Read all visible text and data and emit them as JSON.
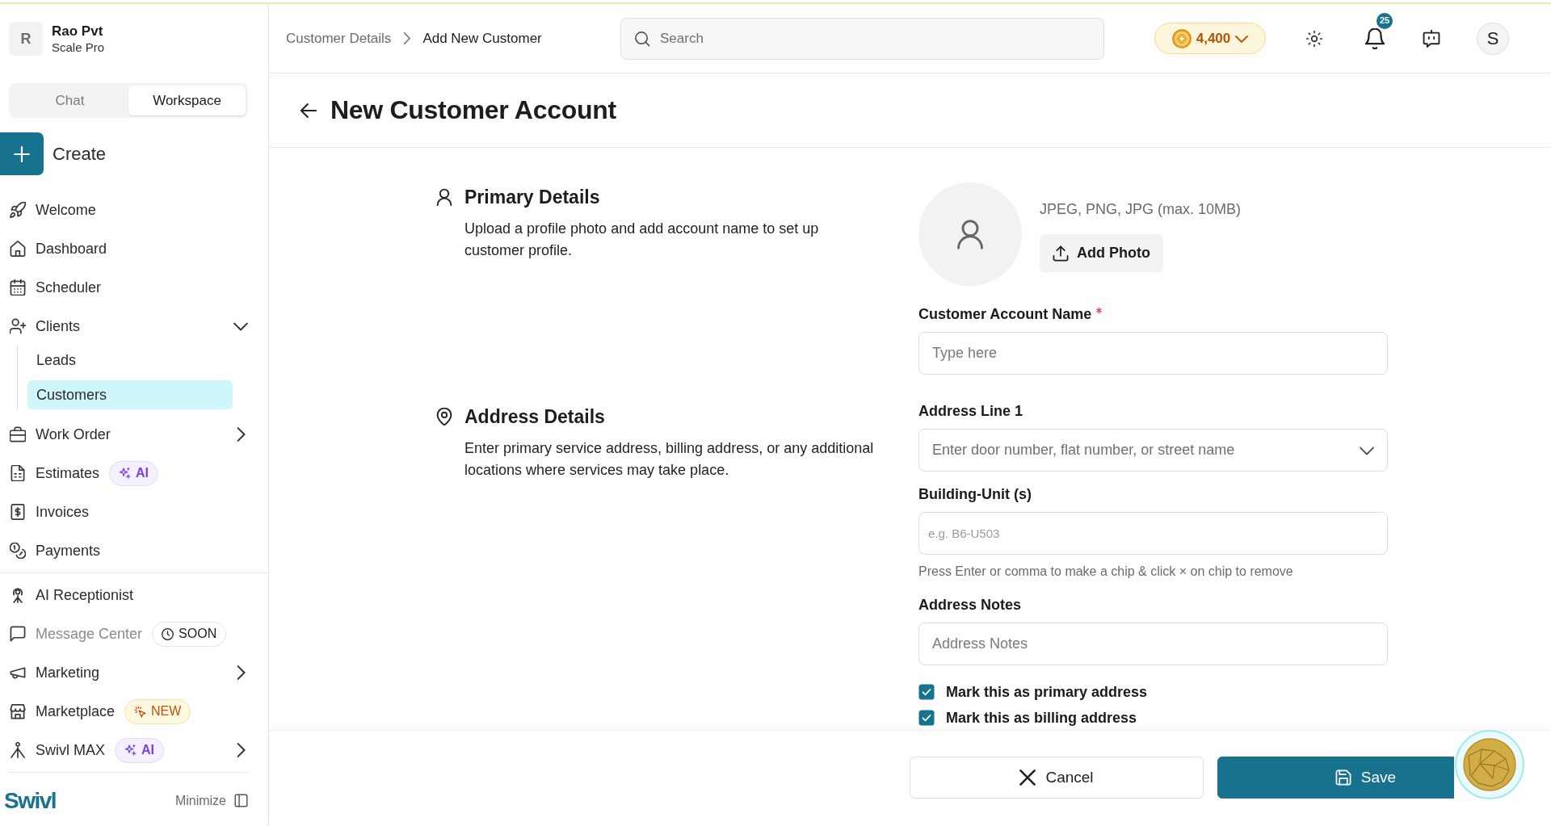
{
  "sidebar": {
    "org": {
      "initial": "R",
      "name": "Rao Pvt",
      "plan": "Scale Pro"
    },
    "mode_tabs": [
      {
        "label": "Chat",
        "selected": false
      },
      {
        "label": "Workspace",
        "selected": true
      }
    ],
    "create_button": {
      "label": "Create"
    },
    "sections": [
      [
        {
          "label": "Welcome",
          "selected": false,
          "disabled": false
        },
        {
          "label": "Dashboard",
          "selected": false,
          "disabled": false
        },
        {
          "label": "Scheduler",
          "selected": false,
          "disabled": false
        },
        {
          "label": "Clients",
          "selected": false,
          "disabled": false,
          "expanded": true,
          "children": [
            {
              "label": "Leads",
              "selected": false
            },
            {
              "label": "Customers",
              "selected": true
            }
          ]
        },
        {
          "label": "Work Order",
          "selected": false,
          "disabled": false,
          "expanded": false
        },
        {
          "label": "Estimates",
          "selected": false,
          "disabled": false,
          "badge": {
            "kind": "ai",
            "label": "AI"
          }
        },
        {
          "label": "Invoices",
          "selected": false,
          "disabled": false
        },
        {
          "label": "Payments",
          "selected": false,
          "disabled": false
        }
      ],
      [
        {
          "label": "AI Receptionist",
          "selected": false,
          "disabled": false
        },
        {
          "label": "Message Center",
          "selected": false,
          "disabled": true,
          "badge": {
            "kind": "soon",
            "label": "SOON"
          }
        },
        {
          "label": "Marketing",
          "selected": false,
          "disabled": false,
          "expanded": false
        },
        {
          "label": "Marketplace",
          "selected": false,
          "disabled": false,
          "badge": {
            "kind": "new",
            "label": "NEW"
          }
        },
        {
          "label": "Swivl MAX",
          "selected": false,
          "disabled": false,
          "badge": {
            "kind": "ai",
            "label": "AI"
          },
          "expanded": false
        }
      ]
    ],
    "footer": {
      "logo": "Swivl",
      "minimize": "Minimize"
    }
  },
  "topbar": {
    "breadcrumb": [
      "Customer Details",
      "Add New Customer"
    ],
    "search": {
      "placeholder": "Search"
    },
    "credits": "4,400",
    "notifications": "25",
    "user_initial": "S"
  },
  "page": {
    "title": "New Customer Account"
  },
  "sections": [
    {
      "kind": "primary",
      "title": "Primary Details",
      "description": "Upload a profile photo and add account name to set up customer profile.",
      "photo": {
        "hint": "JPEG, PNG, JPG (max. 10MB)",
        "button": "Add Photo"
      },
      "fields": [
        {
          "kind": "text",
          "label": "Customer Account Name",
          "required": true,
          "placeholder": "Type here"
        }
      ]
    },
    {
      "kind": "address",
      "title": "Address Details",
      "description": "Enter primary service address, billing address, or any additional locations where services may take place.",
      "fields": [
        {
          "kind": "select",
          "label": "Address Line 1",
          "required": false,
          "placeholder": "Enter door number, flat number, or street name"
        },
        {
          "kind": "chips",
          "label": "Building-Unit (s)",
          "required": false,
          "placeholder": "e.g. B6-U503",
          "help": "Press Enter or comma to make a chip & click × on chip to remove"
        },
        {
          "kind": "text",
          "label": "Address Notes",
          "required": false,
          "placeholder": "Address Notes"
        }
      ],
      "checkboxes": [
        {
          "label": "Mark this as primary address",
          "checked": true
        },
        {
          "label": "Mark this as billing address",
          "checked": true
        }
      ]
    }
  ],
  "actions": [
    {
      "kind": "secondary",
      "label": "Cancel"
    },
    {
      "kind": "primary",
      "label": "Save"
    }
  ]
}
